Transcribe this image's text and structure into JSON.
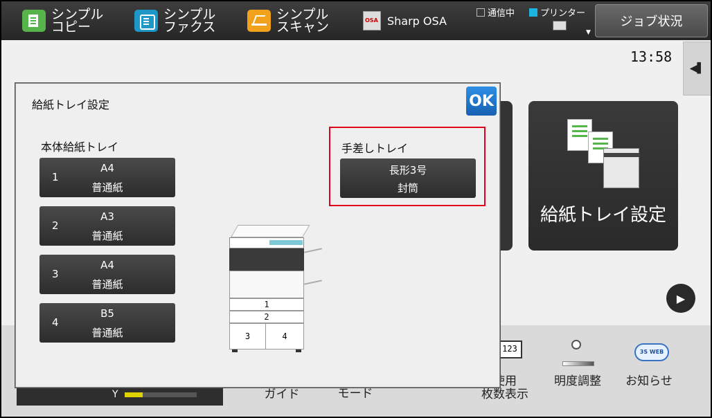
{
  "topbar": {
    "modes": [
      {
        "label": "シンプル\nコピー",
        "icon": "copy-icon"
      },
      {
        "label": "シンプル\nファクス",
        "icon": "fax-icon"
      },
      {
        "label": "シンプル\nスキャン",
        "icon": "scan-icon"
      }
    ],
    "osa_label": "Sharp OSA",
    "status_comm": "通信中",
    "status_printer": "プリンター",
    "job_status": "ジョブ状況",
    "colors": {
      "status_printer": "#1cb4e0"
    }
  },
  "clock": "13:58",
  "background": {
    "tile_tray_label": "給紙トレイ設定"
  },
  "bottombar": {
    "guide": "操作\nガイド",
    "mode": "モード",
    "usage": "使用\n枚数表示",
    "brightness": "明度調整",
    "news": "お知らせ",
    "toner_label": "Y",
    "toner_level": 0.25,
    "counter_digits": "123",
    "cloud_text": "3S WEB"
  },
  "dialog": {
    "title": "給紙トレイ設定",
    "ok_label": "OK",
    "main_trays_label": "本体給紙トレイ",
    "trays": [
      {
        "num": "1",
        "size": "A4",
        "type": "普通紙"
      },
      {
        "num": "2",
        "size": "A3",
        "type": "普通紙"
      },
      {
        "num": "3",
        "size": "A4",
        "type": "普通紙"
      },
      {
        "num": "4",
        "size": "B5",
        "type": "普通紙"
      }
    ],
    "bypass": {
      "label": "手差しトレイ",
      "size": "長形3号",
      "type": "封筒"
    },
    "illustration_trays": [
      "1",
      "2",
      "3",
      "4"
    ]
  }
}
